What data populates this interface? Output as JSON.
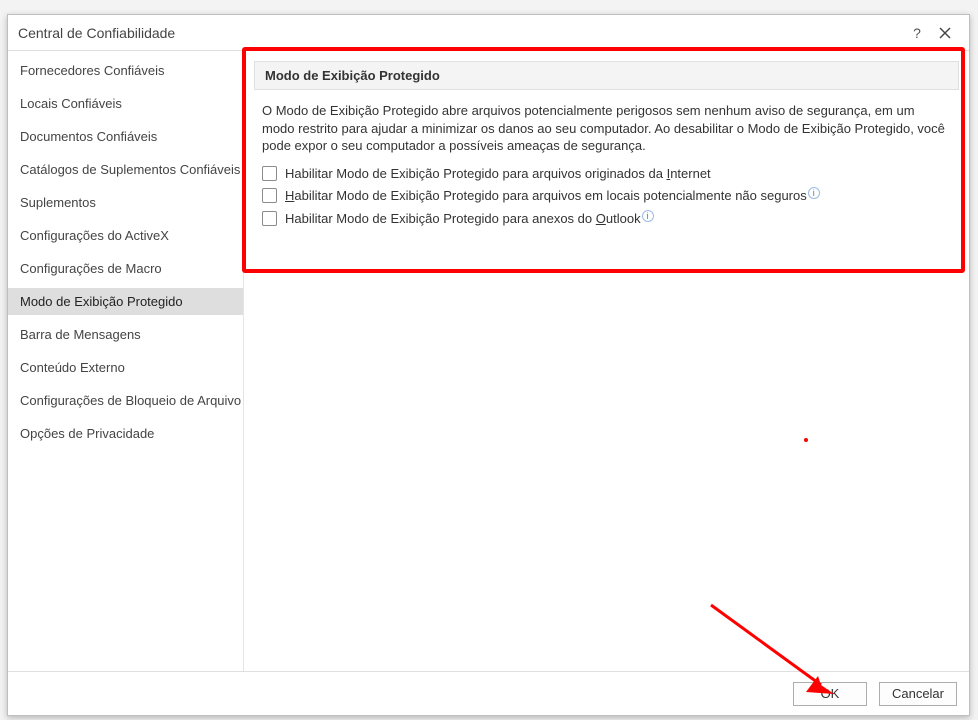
{
  "dialog": {
    "title": "Central de Confiabilidade",
    "help_label": "?",
    "buttons": {
      "ok": "OK",
      "cancel": "Cancelar"
    }
  },
  "sidebar": {
    "items": [
      {
        "label": "Fornecedores Confiáveis",
        "selected": false
      },
      {
        "label": "Locais Confiáveis",
        "selected": false
      },
      {
        "label": "Documentos Confiáveis",
        "selected": false
      },
      {
        "label": "Catálogos de Suplementos Confiáveis",
        "selected": false
      },
      {
        "label": "Suplementos",
        "selected": false
      },
      {
        "label": "Configurações do ActiveX",
        "selected": false
      },
      {
        "label": "Configurações de Macro",
        "selected": false
      },
      {
        "label": "Modo de Exibição Protegido",
        "selected": true
      },
      {
        "label": "Barra de Mensagens",
        "selected": false
      },
      {
        "label": "Conteúdo Externo",
        "selected": false
      },
      {
        "label": "Configurações de Bloqueio de Arquivo",
        "selected": false
      },
      {
        "label": "Opções de Privacidade",
        "selected": false
      }
    ]
  },
  "section": {
    "header": "Modo de Exibição Protegido",
    "description": "O Modo de Exibição Protegido abre arquivos potencialmente perigosos sem nenhum aviso de segurança, em um modo restrito para ajudar a minimizar os danos ao seu computador. Ao desabilitar o Modo de Exibição Protegido, você pode expor o seu computador a possíveis ameaças de segurança.",
    "checks": [
      {
        "pre": "Habilitar Modo de Exibição Protegido para arquivos originados da ",
        "u": "I",
        "post": "nternet",
        "checked": false,
        "info": false
      },
      {
        "pre": "",
        "u": "H",
        "post": "abilitar Modo de Exibição Protegido para arquivos em locais potencialmente não seguros",
        "checked": false,
        "info": true
      },
      {
        "pre": "Habilitar Modo de Exibição Protegido para anexos do ",
        "u": "O",
        "post": "utlook",
        "checked": false,
        "info": true
      }
    ]
  },
  "annotations": {
    "highlight_box": "protected-view-section",
    "arrow_target": "ok-button"
  }
}
